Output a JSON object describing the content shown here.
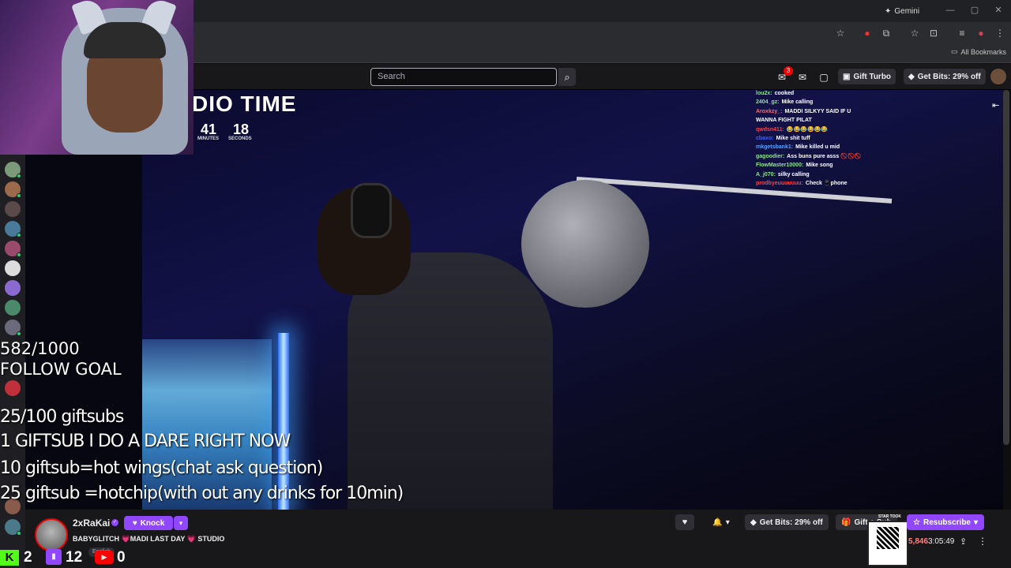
{
  "browser": {
    "gemini_label": "Gemini",
    "all_bookmarks_label": "All Bookmarks",
    "window_min": "—",
    "window_max": "▢",
    "window_close": "✕"
  },
  "nav": {
    "search_placeholder": "Search",
    "notif_count": "3",
    "gift_turbo_label": "Gift Turbo",
    "get_bits_label": "Get Bits: 29% off"
  },
  "video": {
    "title": "DIO TIME",
    "timer_minutes": "41",
    "timer_seconds": "18",
    "minutes_label": "MINUTES",
    "seconds_label": "SECONDS"
  },
  "overlay_chat": [
    {
      "user": "lou2x:",
      "msg": "cooked",
      "color": "#8fe38f"
    },
    {
      "user": "2404_gz:",
      "msg": "Mike calling",
      "color": "#8fe38f"
    },
    {
      "user": "Aroxkzy_:",
      "msg": "MADDI SILKYY SAID IF U",
      "color": "#ff6b6b"
    },
    {
      "user": "",
      "msg": "WANNA FIGHT PILAT",
      "color": "#ffffff"
    },
    {
      "user": "qwdsn411:",
      "msg": "😂😂😂😂😂😂",
      "color": "#ff4040"
    },
    {
      "user": "cbaxo:",
      "msg": "Mike shit tuff",
      "color": "#4060ff"
    },
    {
      "user": "mkgetsbank1:",
      "msg": "Mike killed u mid",
      "color": "#5aa0ff"
    },
    {
      "user": "gagoodier:",
      "msg": "Ass buns pure asss 🚫🚫🚫",
      "color": "#8fe38f"
    },
    {
      "user": "FlowMaster10000:",
      "msg": "Mike song",
      "color": "#8fe38f"
    },
    {
      "user": "A_j070:",
      "msg": "silky calling",
      "color": "#8fe38f"
    },
    {
      "user": "prodbyeuuuuuuu:",
      "msg": "Check 📱phone",
      "color": "#ff4040"
    }
  ],
  "goals": {
    "follow_count": "582/1000",
    "follow_label": "FOLLOW GOAL",
    "giftsubs_count": "25/100 giftsubs",
    "line1": "1 GIFTSUB I DO A DARE RIGHT NOW",
    "line2": "10 giftsub=hot wings(chat ask question)",
    "line3": "25 giftsub =hotchip(with out any drinks for 10min)"
  },
  "channel": {
    "name": "2xRaKai",
    "knock_label": "Knock",
    "stream_title": "BABYGLITCH 💗MADI LAST DAY 💗 STUDIO",
    "language_tag": "English",
    "viewer_count": "5,846",
    "uptime": "3:05:49",
    "bits_label": "Get Bits: 29% off",
    "gift_sub_label": "Gift a Sub",
    "resubscribe_label": "Resubscribe",
    "qr_caption": "STAR TOOK"
  },
  "socials": {
    "kick_count": "2",
    "twitch_count": "12",
    "youtube_count": "0"
  },
  "colors": {
    "twitch_purple": "#9147ff",
    "kick_green": "#53fc18",
    "youtube_red": "#ff0000"
  }
}
